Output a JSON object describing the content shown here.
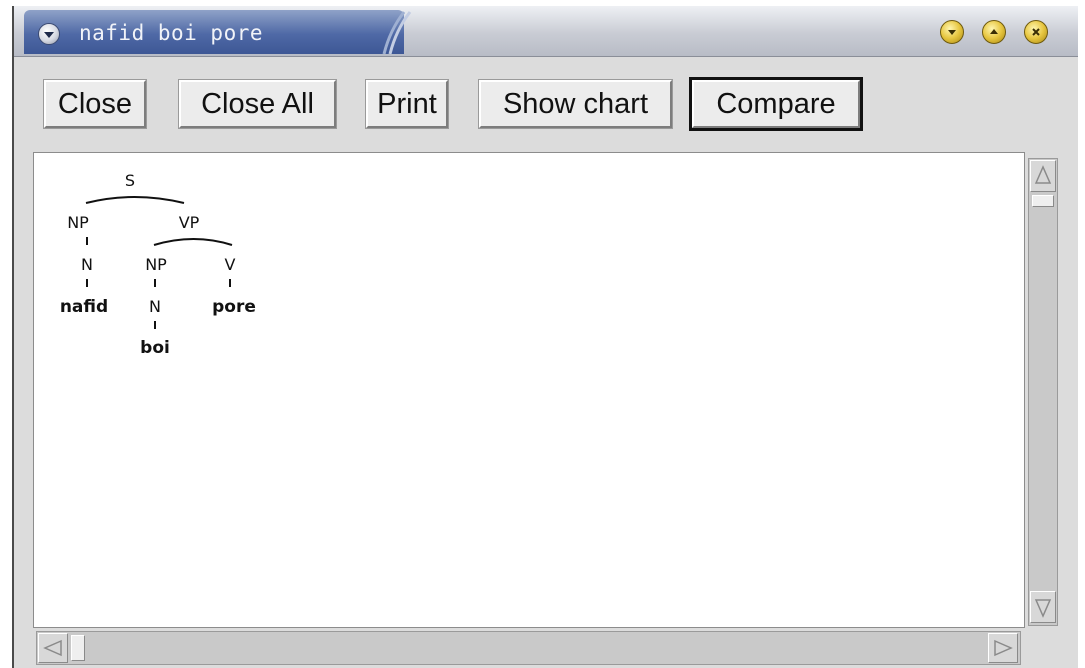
{
  "window": {
    "title": "nafid boi pore",
    "controls": {
      "minimize_icon": "minimize-icon",
      "maximize_icon": "maximize-icon",
      "close_icon": "close-icon"
    }
  },
  "toolbar": {
    "close_label": "Close",
    "close_all_label": "Close All",
    "print_label": "Print",
    "show_chart_label": "Show chart",
    "compare_label": "Compare"
  },
  "tree": {
    "root": "S",
    "np_left": "NP",
    "vp": "VP",
    "n_left": "N",
    "np_inner": "NP",
    "v": "V",
    "word_nafid": "nafid",
    "n_inner": "N",
    "word_pore": "pore",
    "word_boi": "boi"
  },
  "colors": {
    "titlebar_tab": "#4f69a6",
    "window_bg": "#dcdcdc",
    "wm_buttons": "#e7c640"
  }
}
